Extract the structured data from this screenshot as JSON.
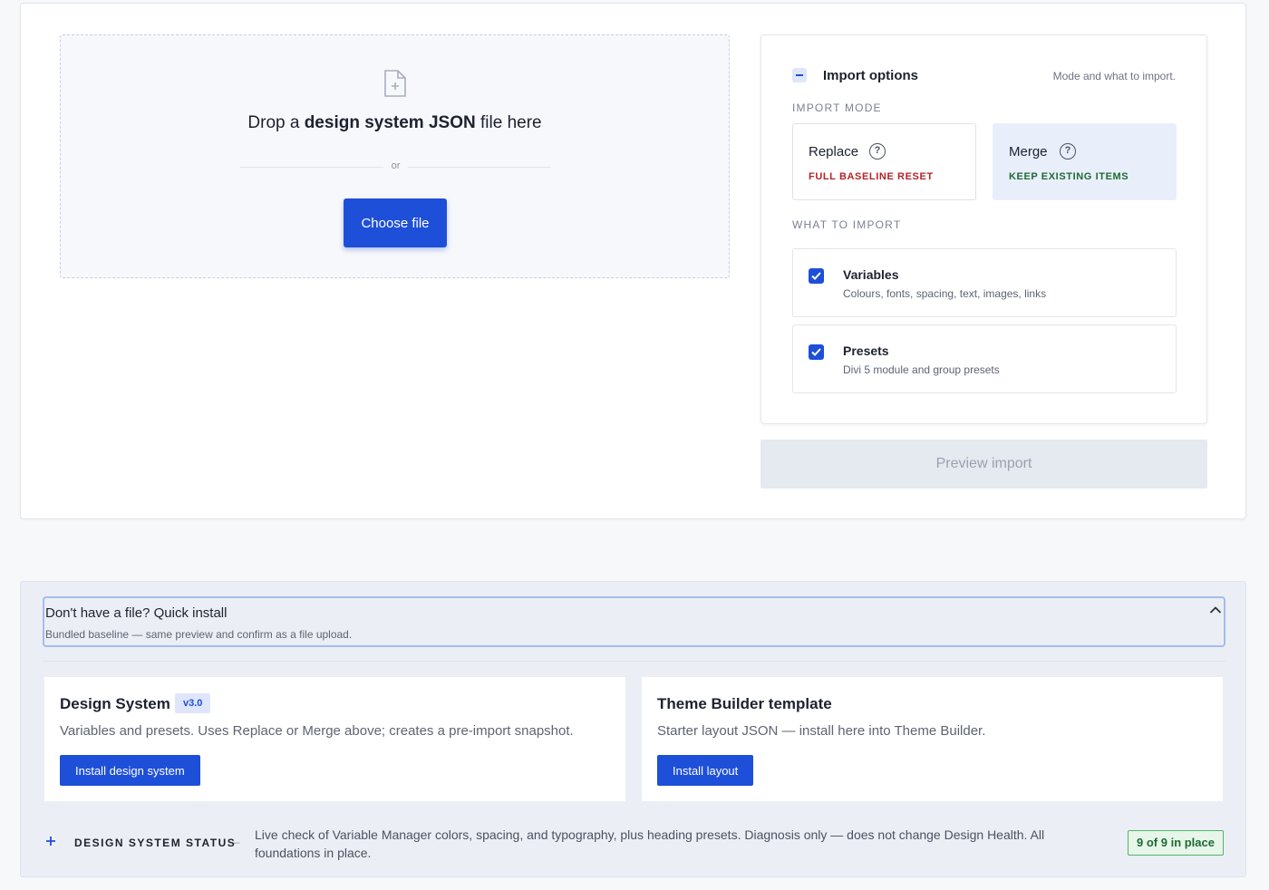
{
  "dropzone": {
    "title_prefix": "Drop a ",
    "title_bold": "design system JSON",
    "title_suffix": " file here",
    "or_label": "or",
    "choose_label": "Choose file",
    "icon": "file-plus-icon"
  },
  "import_options": {
    "title": "Import options",
    "hint": "Mode and what to import.",
    "mode_label": "IMPORT MODE",
    "modes": [
      {
        "name": "Replace",
        "sub": "FULL BASELINE RESET",
        "color": "#b4232a",
        "selected": false
      },
      {
        "name": "Merge",
        "sub": "KEEP EXISTING ITEMS",
        "color": "#1e6b33",
        "selected": true
      }
    ],
    "what_label": "WHAT TO IMPORT",
    "items": [
      {
        "title": "Variables",
        "desc": "Colours, fonts, spacing, text, images, links",
        "checked": true
      },
      {
        "title": "Presets",
        "desc": "Divi 5 module and group presets",
        "checked": true
      }
    ]
  },
  "preview_label": "Preview import",
  "quick_install": {
    "title": "Don't have a file? Quick install",
    "subtitle": "Bundled baseline — same preview and confirm as a file upload.",
    "cards": [
      {
        "title": "Design System",
        "badge": "v3.0",
        "desc": "Variables and presets. Uses Replace or Merge above; creates a pre-import snapshot.",
        "button": "Install design system"
      },
      {
        "title": "Theme Builder template",
        "desc": "Starter layout JSON — install here into Theme Builder.",
        "button": "Install layout"
      }
    ]
  },
  "status": {
    "label": "DESIGN SYSTEM STATUS",
    "dash": "–",
    "text": "Live check of Variable Manager colors, spacing, and typography, plus heading presets. Diagnosis only — does not change Design Health. All foundations in place.",
    "badge": "9 of 9 in place"
  },
  "colors": {
    "accent": "#1e4fd8",
    "success": "#1e6b33",
    "danger": "#b4232a"
  }
}
